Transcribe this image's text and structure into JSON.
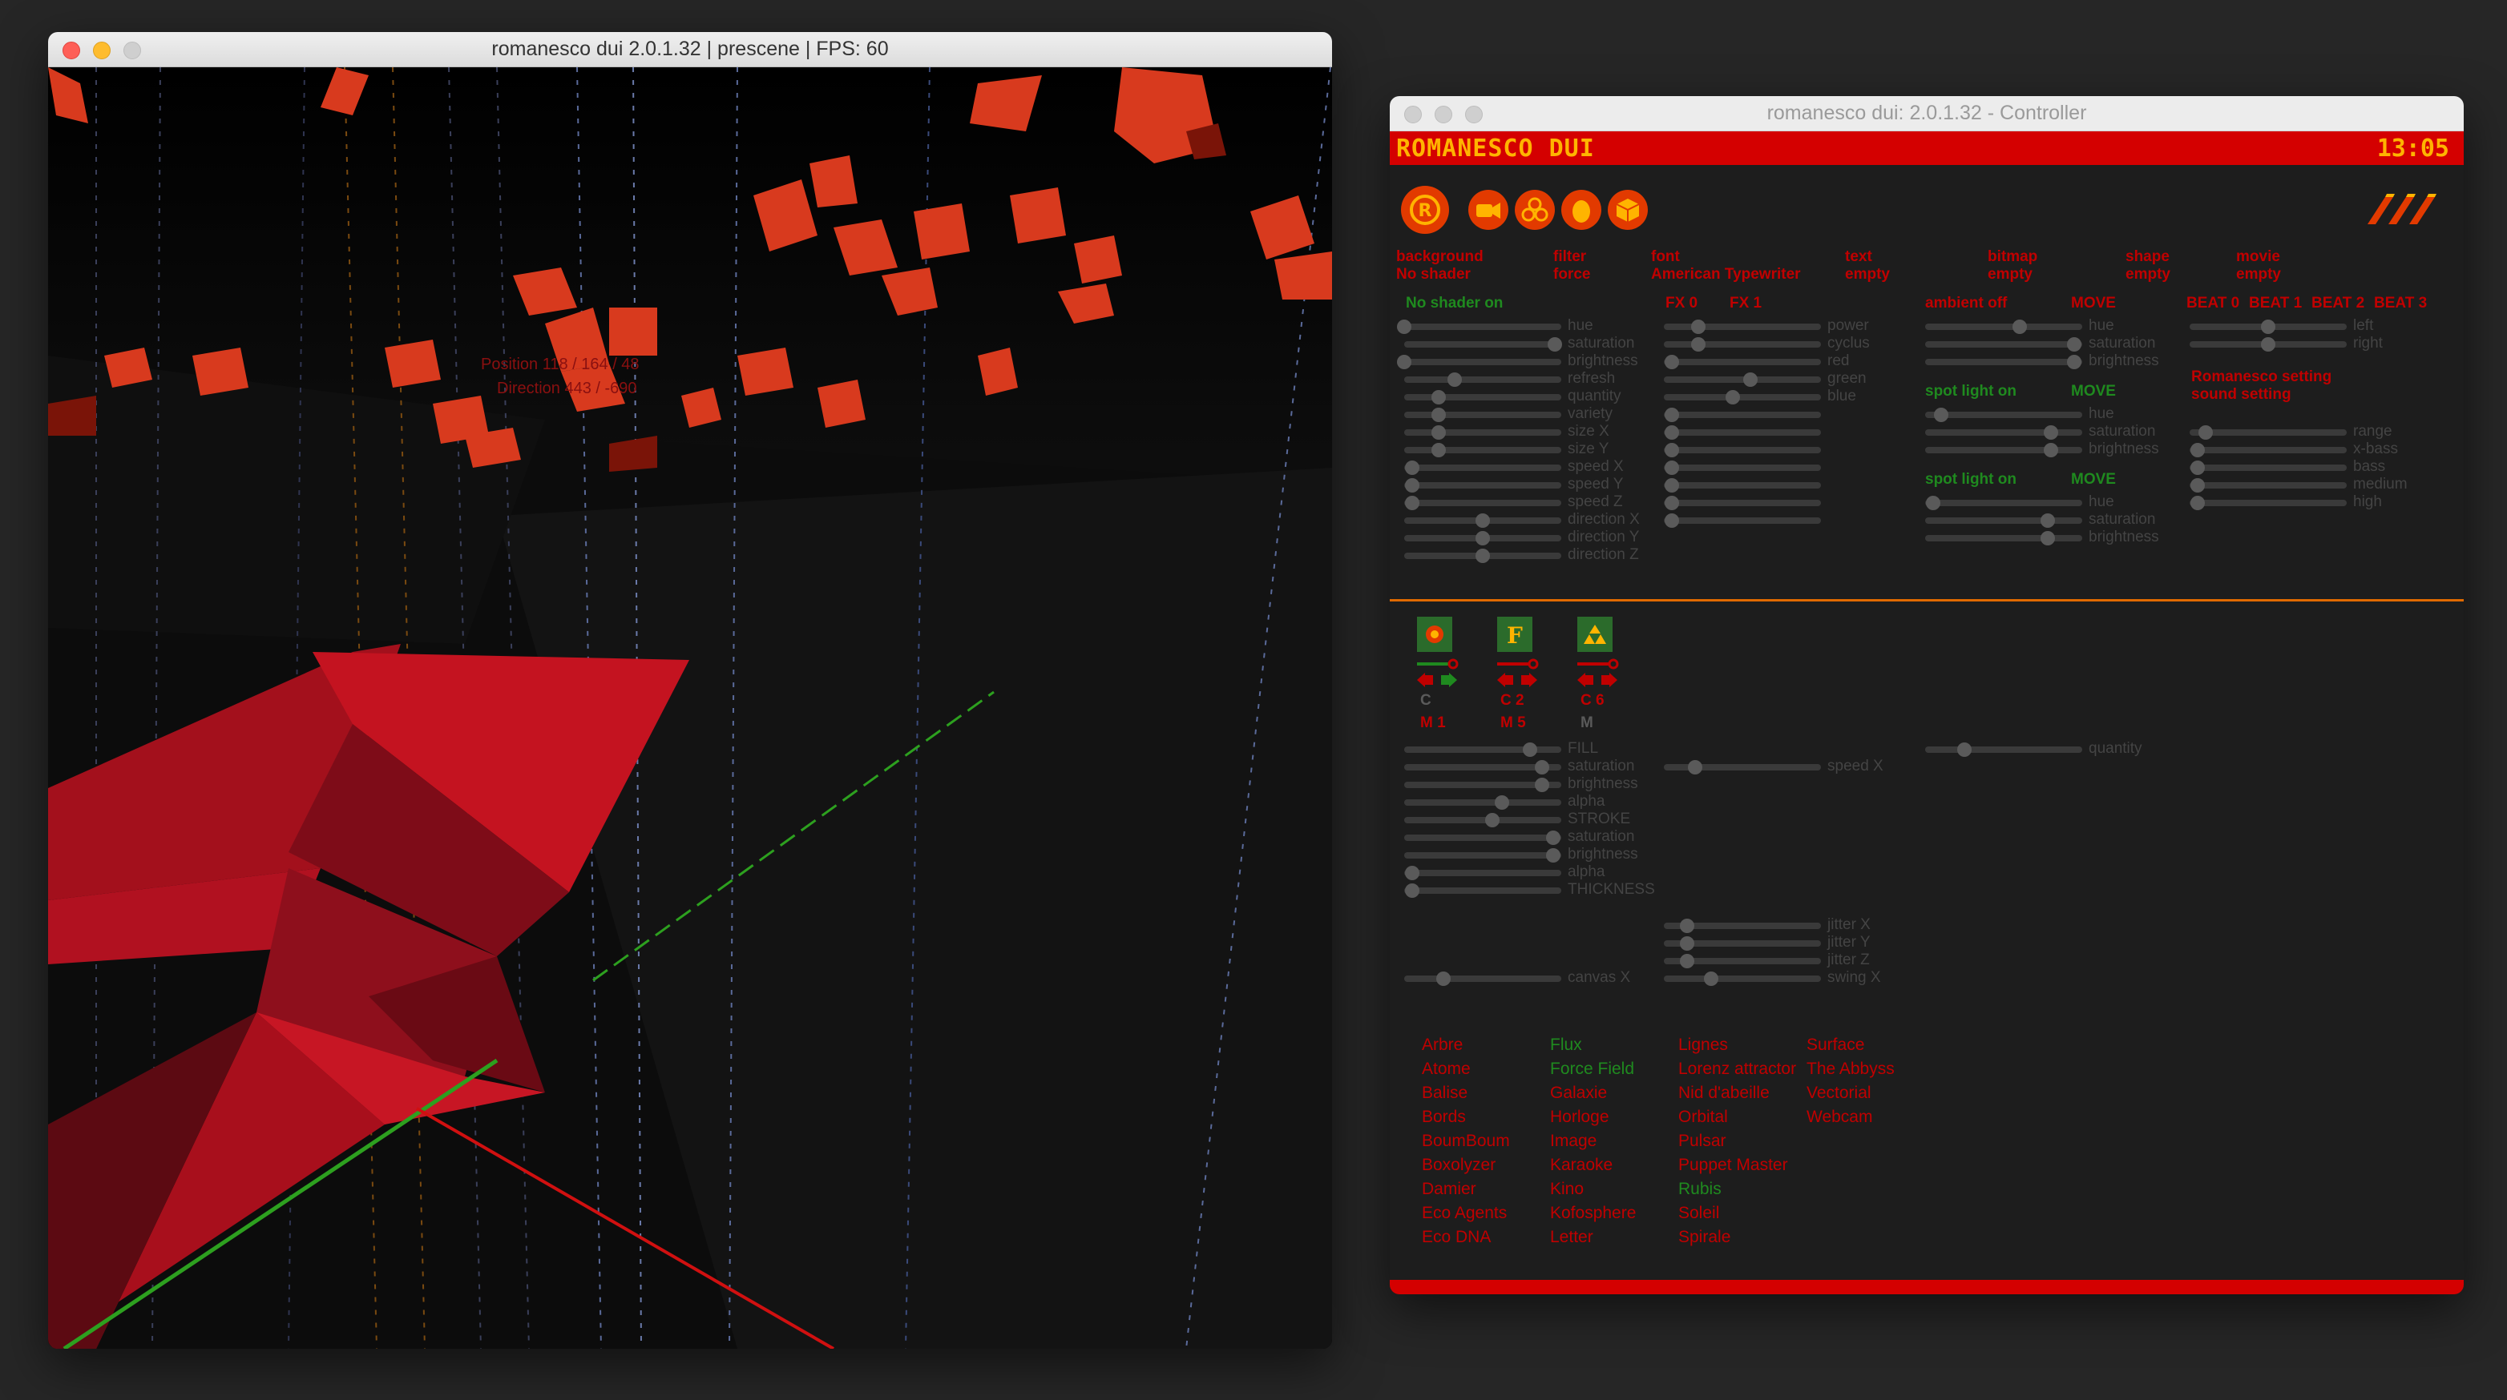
{
  "prescene": {
    "title": "romanesco dui 2.0.1.32 | prescene | FPS: 60",
    "hud_position": "Position 118 / 164 / 48",
    "hud_direction": "Direction 443 / -690"
  },
  "controller": {
    "title": "romanesco dui: 2.0.1.32 - Controller",
    "brand": "ROMANESCO DUI",
    "clock": "13:05",
    "menu": [
      {
        "heading": "background",
        "value": "No shader"
      },
      {
        "heading": "filter",
        "value": "force"
      },
      {
        "heading": "font",
        "value": "American Typewriter"
      },
      {
        "heading": "text",
        "value": "empty"
      },
      {
        "heading": "bitmap",
        "value": "empty"
      },
      {
        "heading": "shape",
        "value": "empty"
      },
      {
        "heading": "movie",
        "value": "empty"
      }
    ],
    "shader_status": "No shader on",
    "fx0": "FX 0",
    "fx1": "FX 1",
    "ambient": "ambient off",
    "spot1": "spot light on",
    "spot2": "spot light on",
    "move": "MOVE",
    "beats": [
      "BEAT 0",
      "BEAT 1",
      "BEAT 2",
      "BEAT 3"
    ],
    "romanesco_setting": "Romanesco setting",
    "sound_setting": "sound setting",
    "bg_sliders": [
      {
        "label": "hue",
        "value": 0.0
      },
      {
        "label": "saturation",
        "value": 0.96
      },
      {
        "label": "brightness",
        "value": 0.0
      },
      {
        "label": "refresh",
        "value": 0.32
      },
      {
        "label": "quantity",
        "value": 0.22
      },
      {
        "label": "variety",
        "value": 0.22
      },
      {
        "label": "size X",
        "value": 0.22
      },
      {
        "label": "size Y",
        "value": 0.22
      },
      {
        "label": "speed X",
        "value": 0.05
      },
      {
        "label": "speed Y",
        "value": 0.05
      },
      {
        "label": "speed Z",
        "value": 0.05
      },
      {
        "label": "direction X",
        "value": 0.5
      },
      {
        "label": "direction Y",
        "value": 0.5
      },
      {
        "label": "direction Z",
        "value": 0.5
      }
    ],
    "fx_sliders": [
      {
        "label": "power",
        "value": 0.22
      },
      {
        "label": "cyclus",
        "value": 0.22
      },
      {
        "label": "red",
        "value": 0.05
      },
      {
        "label": "green",
        "value": 0.55
      },
      {
        "label": "blue",
        "value": 0.44
      },
      {
        "label": "",
        "value": 0.05
      },
      {
        "label": "",
        "value": 0.05
      },
      {
        "label": "",
        "value": 0.05
      },
      {
        "label": "",
        "value": 0.05
      },
      {
        "label": "",
        "value": 0.05
      },
      {
        "label": "",
        "value": 0.05
      },
      {
        "label": "",
        "value": 0.05
      }
    ],
    "ambient_sliders": [
      {
        "label": "hue",
        "value": 0.6
      },
      {
        "label": "saturation",
        "value": 0.95
      },
      {
        "label": "brightness",
        "value": 0.95
      }
    ],
    "spot1_sliders": [
      {
        "label": "hue",
        "value": 0.1
      },
      {
        "label": "saturation",
        "value": 0.8
      },
      {
        "label": "brightness",
        "value": 0.8
      }
    ],
    "spot2_sliders": [
      {
        "label": "hue",
        "value": 0.05
      },
      {
        "label": "saturation",
        "value": 0.78
      },
      {
        "label": "brightness",
        "value": 0.78
      }
    ],
    "beat_sliders": [
      {
        "label": "left",
        "value": 0.5
      },
      {
        "label": "right",
        "value": 0.5
      }
    ],
    "sound_sliders": [
      {
        "label": "range",
        "value": 0.1
      },
      {
        "label": "x-bass",
        "value": 0.05
      },
      {
        "label": "bass",
        "value": 0.05
      },
      {
        "label": "medium",
        "value": 0.05
      },
      {
        "label": "high",
        "value": 0.05
      }
    ],
    "items": [
      {
        "icon": "flower-icon",
        "code": "C",
        "mode": "M 1"
      },
      {
        "icon": "letter-f-icon",
        "code": "C 2",
        "mode": "M 5"
      },
      {
        "icon": "triangles-icon",
        "code": "C 6",
        "mode": "M"
      }
    ],
    "item_sliders": [
      {
        "label": "FILL",
        "value": 0.8
      },
      {
        "label": "saturation",
        "value": 0.88
      },
      {
        "label": "brightness",
        "value": 0.88
      },
      {
        "label": "alpha",
        "value": 0.62
      },
      {
        "label": "STROKE",
        "value": 0.56
      },
      {
        "label": "saturation",
        "value": 0.95
      },
      {
        "label": "brightness",
        "value": 0.95
      },
      {
        "label": "alpha",
        "value": 0.05
      },
      {
        "label": "THICKNESS",
        "value": 0.05
      }
    ],
    "speed_x": {
      "label": "speed X",
      "value": 0.2
    },
    "quantity": {
      "label": "quantity",
      "value": 0.25
    },
    "canvas_x": {
      "label": "canvas X",
      "value": 0.25
    },
    "jitter_sliders": [
      {
        "label": "jitter X",
        "value": 0.15
      },
      {
        "label": "jitter Y",
        "value": 0.15
      },
      {
        "label": "jitter Z",
        "value": 0.15
      },
      {
        "label": "swing X",
        "value": 0.3
      }
    ],
    "objects": {
      "col1": [
        "Arbre",
        "Atome",
        "Balise",
        "Bords",
        "BoumBoum",
        "Boxolyzer",
        "Damier",
        "Eco Agents",
        "Eco DNA"
      ],
      "col2": [
        "Flux",
        "Force Field",
        "Galaxie",
        "Horloge",
        "Image",
        "Karaoke",
        "Kino",
        "Kofosphere",
        "Letter"
      ],
      "col3": [
        "Lignes",
        "Lorenz attractor",
        "Nid d'abeille",
        "Orbital",
        "Pulsar",
        "Puppet Master",
        "Rubis",
        "Soleil",
        "Spirale"
      ],
      "col4": [
        "Surface",
        "The Abbyss",
        "Vectorial",
        "Webcam"
      ],
      "active": [
        "Flux",
        "Force Field",
        "Rubis"
      ]
    }
  },
  "colors": {
    "accent_red": "#d40000",
    "brand_yellow": "#ffb400",
    "separator_orange": "#e06a00",
    "active_green": "#1f8a1f",
    "inactive_red": "#c00000"
  }
}
